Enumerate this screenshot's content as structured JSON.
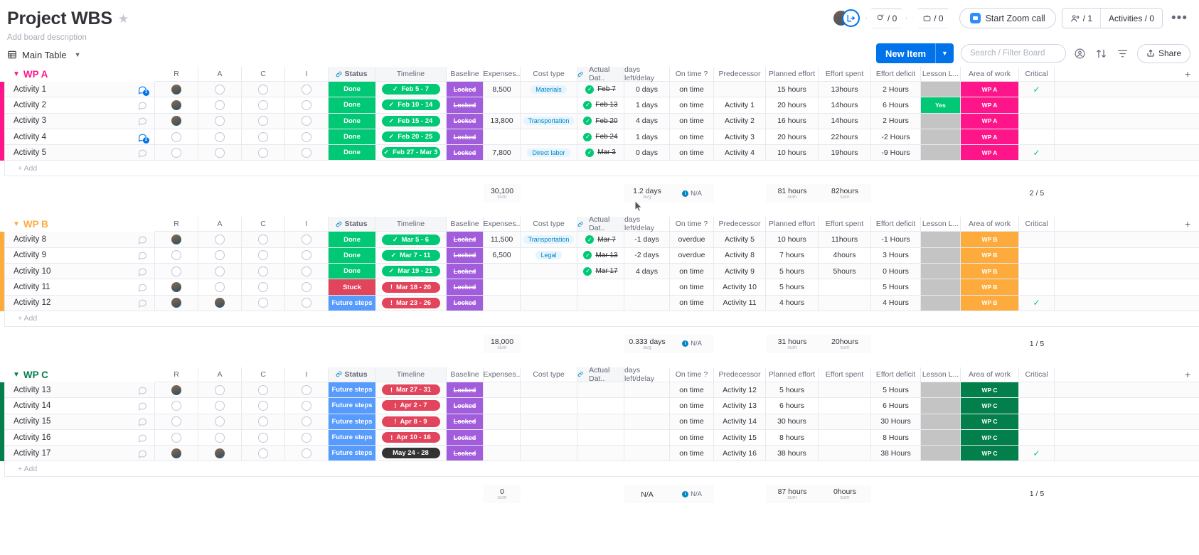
{
  "header": {
    "title": "Project WBS",
    "star_icon": "star-icon",
    "description": "Add board description",
    "view_tab": "Main Table",
    "grid_icon": "grid-icon",
    "people_count": "/ 0",
    "robot_count": "/ 0",
    "zoom_call": "Start Zoom call",
    "members": "/ 1",
    "activities": "Activities / 0",
    "dots": "•••"
  },
  "toolbar": {
    "new_item": "New Item",
    "new_item_caret": "∨",
    "search_placeholder": "Search / Filter Board",
    "person_icon": "person-filter-icon",
    "sort_icon": "sort-icon",
    "filter_icon": "filter-icon",
    "share": "Share",
    "share_icon": "share-icon"
  },
  "columns": [
    {
      "key": "R",
      "label": "R"
    },
    {
      "key": "A",
      "label": "A"
    },
    {
      "key": "C",
      "label": "C"
    },
    {
      "key": "I",
      "label": "I"
    },
    {
      "key": "status",
      "label": "Status",
      "linked": true
    },
    {
      "key": "timeline",
      "label": "Timeline"
    },
    {
      "key": "baseline",
      "label": "Baseline"
    },
    {
      "key": "expenses",
      "label": "Expenses.."
    },
    {
      "key": "cost_type",
      "label": "Cost type"
    },
    {
      "key": "actual_date",
      "label": "Actual Dat..",
      "linked": true
    },
    {
      "key": "days_left",
      "label": "days left/delay"
    },
    {
      "key": "on_time",
      "label": "On time ?"
    },
    {
      "key": "predecessor",
      "label": "Predecessor"
    },
    {
      "key": "planned_effort",
      "label": "Planned effort"
    },
    {
      "key": "effort_spent",
      "label": "Effort spent"
    },
    {
      "key": "effort_deficit",
      "label": "Effort deficit"
    },
    {
      "key": "lesson",
      "label": "Lesson L..."
    },
    {
      "key": "area",
      "label": "Area of work"
    },
    {
      "key": "critical",
      "label": "Critical"
    }
  ],
  "add_label": "+ Add",
  "colors": {
    "wpa": "#ff158a",
    "wpb": "#fdab3d",
    "wpc": "#037f4c",
    "done": "#00c875",
    "stuck": "#e2445c",
    "future": "#579bfc",
    "locked": "#a25ddc",
    "dark": "#333333",
    "blue": "#0073ea",
    "grey": "#c4c4c4",
    "green_cell": "#00c875"
  },
  "groups": [
    {
      "name": "WP A",
      "color": "#ff158a",
      "rows": [
        {
          "name": "Activity 1",
          "chat": "1",
          "chat_active": true,
          "R": "img",
          "A": "ph",
          "C": "ph",
          "I": "ph",
          "status": "Done",
          "status_color": "#00c875",
          "timeline": "Feb 5 - 7",
          "tl_color": "#00c875",
          "tl_mark": "✓",
          "baseline": "Locked",
          "expenses": "8,500",
          "cost_type": "Materials",
          "actual": "Feb 7",
          "actual_ok": true,
          "days": "0 days",
          "on_time": "on time",
          "pred": "",
          "pe": "15 hours",
          "es": "13hours",
          "ed": "2 Hours",
          "lesson": "",
          "lesson_color": "#c4c4c4",
          "area": "WP A",
          "critical": true
        },
        {
          "name": "Activity 2",
          "chat": "",
          "chat_active": false,
          "R": "img",
          "A": "ph",
          "C": "ph",
          "I": "ph",
          "status": "Done",
          "status_color": "#00c875",
          "timeline": "Feb 10 - 14",
          "tl_color": "#00c875",
          "tl_mark": "✓",
          "baseline": "Locked",
          "expenses": "",
          "cost_type": "",
          "actual": "Feb 13",
          "actual_ok": true,
          "days": "1 days",
          "on_time": "on time",
          "pred": "Activity 1",
          "pe": "20 hours",
          "es": "14hours",
          "ed": "6 Hours",
          "lesson": "Yes",
          "lesson_color": "#00c875",
          "area": "WP A",
          "critical": false
        },
        {
          "name": "Activity 3",
          "chat": "",
          "chat_active": false,
          "R": "img",
          "A": "ph",
          "C": "ph",
          "I": "ph",
          "status": "Done",
          "status_color": "#00c875",
          "timeline": "Feb 15 - 24",
          "tl_color": "#00c875",
          "tl_mark": "✓",
          "baseline": "Locked",
          "expenses": "13,800",
          "cost_type": "Transportation",
          "actual": "Feb 20",
          "actual_ok": true,
          "days": "4 days",
          "on_time": "on time",
          "pred": "Activity 2",
          "pe": "16 hours",
          "es": "14hours",
          "ed": "2 Hours",
          "lesson": "",
          "lesson_color": "#c4c4c4",
          "area": "WP A",
          "critical": false
        },
        {
          "name": "Activity 4",
          "chat": "2",
          "chat_active": true,
          "R": "ph",
          "A": "ph",
          "C": "ph",
          "I": "ph",
          "status": "Done",
          "status_color": "#00c875",
          "timeline": "Feb 20 - 25",
          "tl_color": "#00c875",
          "tl_mark": "✓",
          "baseline": "Locked",
          "expenses": "",
          "cost_type": "",
          "actual": "Feb 24",
          "actual_ok": true,
          "days": "1 days",
          "on_time": "on time",
          "pred": "Activity 3",
          "pe": "20 hours",
          "es": "22hours",
          "ed": "-2 Hours",
          "lesson": "",
          "lesson_color": "#c4c4c4",
          "area": "WP A",
          "critical": false
        },
        {
          "name": "Activity 5",
          "chat": "",
          "chat_active": false,
          "R": "ph",
          "A": "ph",
          "C": "ph",
          "I": "ph",
          "status": "Done",
          "status_color": "#00c875",
          "timeline": "Feb 27 - Mar 3",
          "tl_color": "#00c875",
          "tl_mark": "✓",
          "baseline": "Locked",
          "expenses": "7,800",
          "cost_type": "Direct labor",
          "actual": "Mar 3",
          "actual_ok": true,
          "days": "0 days",
          "on_time": "on time",
          "pred": "Activity 4",
          "pe": "10 hours",
          "es": "19hours",
          "ed": "-9 Hours",
          "lesson": "",
          "lesson_color": "#c4c4c4",
          "area": "WP A",
          "critical": true
        }
      ],
      "summary": {
        "expenses": "30,100",
        "expenses_sub": "sum",
        "days": "1.2 days",
        "days_sub": "avg",
        "on_time": "N/A",
        "pe": "81 hours",
        "pe_sub": "sum",
        "es": "82hours",
        "es_sub": "sum",
        "critical": "2 / 5"
      }
    },
    {
      "name": "WP B",
      "color": "#fdab3d",
      "rows": [
        {
          "name": "Activity 8",
          "chat": "",
          "chat_active": false,
          "R": "img",
          "A": "ph",
          "C": "ph",
          "I": "ph",
          "status": "Done",
          "status_color": "#00c875",
          "timeline": "Mar 5 - 6",
          "tl_color": "#00c875",
          "tl_mark": "✓",
          "baseline": "Locked",
          "expenses": "11,500",
          "cost_type": "Transportation",
          "actual": "Mar 7",
          "actual_ok": true,
          "days": "-1 days",
          "on_time": "overdue",
          "pred": "Activity 5",
          "pe": "10 hours",
          "es": "11hours",
          "ed": "-1 Hours",
          "lesson": "",
          "lesson_color": "#c4c4c4",
          "area": "WP B",
          "critical": false
        },
        {
          "name": "Activity 9",
          "chat": "",
          "chat_active": false,
          "R": "ph",
          "A": "ph",
          "C": "ph",
          "I": "ph",
          "status": "Done",
          "status_color": "#00c875",
          "timeline": "Mar 7 - 11",
          "tl_color": "#00c875",
          "tl_mark": "✓",
          "baseline": "Locked",
          "expenses": "6,500",
          "cost_type": "Legal",
          "actual": "Mar 13",
          "actual_ok": true,
          "days": "-2 days",
          "on_time": "overdue",
          "pred": "Activity 8",
          "pe": "7 hours",
          "es": "4hours",
          "ed": "3 Hours",
          "lesson": "",
          "lesson_color": "#c4c4c4",
          "area": "WP B",
          "critical": false
        },
        {
          "name": "Activity 10",
          "chat": "",
          "chat_active": false,
          "R": "ph",
          "A": "ph",
          "C": "ph",
          "I": "ph",
          "status": "Done",
          "status_color": "#00c875",
          "timeline": "Mar 19 - 21",
          "tl_color": "#00c875",
          "tl_mark": "✓",
          "baseline": "Locked",
          "expenses": "",
          "cost_type": "",
          "actual": "Mar 17",
          "actual_ok": true,
          "days": "4 days",
          "on_time": "on time",
          "pred": "Activity 9",
          "pe": "5 hours",
          "es": "5hours",
          "ed": "0 Hours",
          "lesson": "",
          "lesson_color": "#c4c4c4",
          "area": "WP B",
          "critical": false
        },
        {
          "name": "Activity 11",
          "chat": "",
          "chat_active": false,
          "R": "img",
          "A": "ph",
          "C": "ph",
          "I": "ph",
          "status": "Stuck",
          "status_color": "#e2445c",
          "timeline": "Mar 18 - 20",
          "tl_color": "#e2445c",
          "tl_mark": "!",
          "baseline": "Locked",
          "expenses": "",
          "cost_type": "",
          "actual": "",
          "actual_ok": false,
          "days": "",
          "on_time": "on time",
          "pred": "Activity 10",
          "pe": "5 hours",
          "es": "",
          "ed": "5 Hours",
          "lesson": "",
          "lesson_color": "#c4c4c4",
          "area": "WP B",
          "critical": false
        },
        {
          "name": "Activity 12",
          "chat": "",
          "chat_active": false,
          "R": "img",
          "A": "img",
          "C": "ph",
          "I": "ph",
          "status": "Future steps",
          "status_color": "#579bfc",
          "timeline": "Mar 23 - 26",
          "tl_color": "#e2445c",
          "tl_mark": "!",
          "baseline": "Locked",
          "expenses": "",
          "cost_type": "",
          "actual": "",
          "actual_ok": false,
          "days": "",
          "on_time": "on time",
          "pred": "Activity 11",
          "pe": "4 hours",
          "es": "",
          "ed": "4 Hours",
          "lesson": "",
          "lesson_color": "#c4c4c4",
          "area": "WP B",
          "critical": true
        }
      ],
      "summary": {
        "expenses": "18,000",
        "expenses_sub": "sum",
        "days": "0.333 days",
        "days_sub": "avg",
        "on_time": "N/A",
        "pe": "31 hours",
        "pe_sub": "sum",
        "es": "20hours",
        "es_sub": "sum",
        "critical": "1 / 5"
      }
    },
    {
      "name": "WP C",
      "color": "#037f4c",
      "rows": [
        {
          "name": "Activity 13",
          "chat": "",
          "chat_active": false,
          "R": "img",
          "A": "ph",
          "C": "ph",
          "I": "ph",
          "status": "Future steps",
          "status_color": "#579bfc",
          "timeline": "Mar 27 - 31",
          "tl_color": "#e2445c",
          "tl_mark": "!",
          "baseline": "Locked",
          "expenses": "",
          "cost_type": "",
          "actual": "",
          "actual_ok": false,
          "days": "",
          "on_time": "on time",
          "pred": "Activity 12",
          "pe": "5 hours",
          "es": "",
          "ed": "5 Hours",
          "lesson": "",
          "lesson_color": "#c4c4c4",
          "area": "WP C",
          "critical": false
        },
        {
          "name": "Activity 14",
          "chat": "",
          "chat_active": false,
          "R": "ph",
          "A": "ph",
          "C": "ph",
          "I": "ph",
          "status": "Future steps",
          "status_color": "#579bfc",
          "timeline": "Apr 2 - 7",
          "tl_color": "#e2445c",
          "tl_mark": "!",
          "baseline": "Locked",
          "expenses": "",
          "cost_type": "",
          "actual": "",
          "actual_ok": false,
          "days": "",
          "on_time": "on time",
          "pred": "Activity 13",
          "pe": "6 hours",
          "es": "",
          "ed": "6 Hours",
          "lesson": "",
          "lesson_color": "#c4c4c4",
          "area": "WP C",
          "critical": false
        },
        {
          "name": "Activity 15",
          "chat": "",
          "chat_active": false,
          "R": "ph",
          "A": "ph",
          "C": "ph",
          "I": "ph",
          "status": "Future steps",
          "status_color": "#579bfc",
          "timeline": "Apr 8 - 9",
          "tl_color": "#e2445c",
          "tl_mark": "!",
          "baseline": "Locked",
          "expenses": "",
          "cost_type": "",
          "actual": "",
          "actual_ok": false,
          "days": "",
          "on_time": "on time",
          "pred": "Activity 14",
          "pe": "30 hours",
          "es": "",
          "ed": "30 Hours",
          "lesson": "",
          "lesson_color": "#c4c4c4",
          "area": "WP C",
          "critical": false
        },
        {
          "name": "Activity 16",
          "chat": "",
          "chat_active": false,
          "R": "ph",
          "A": "ph",
          "C": "ph",
          "I": "ph",
          "status": "Future steps",
          "status_color": "#579bfc",
          "timeline": "Apr 10 - 16",
          "tl_color": "#e2445c",
          "tl_mark": "!",
          "baseline": "Locked",
          "expenses": "",
          "cost_type": "",
          "actual": "",
          "actual_ok": false,
          "days": "",
          "on_time": "on time",
          "pred": "Activity 15",
          "pe": "8 hours",
          "es": "",
          "ed": "8 Hours",
          "lesson": "",
          "lesson_color": "#c4c4c4",
          "area": "WP C",
          "critical": false
        },
        {
          "name": "Activity 17",
          "chat": "",
          "chat_active": false,
          "R": "img",
          "A": "img",
          "C": "ph",
          "I": "ph",
          "status": "Future steps",
          "status_color": "#579bfc",
          "timeline": "May 24 - 28",
          "tl_color": "#333333",
          "tl_mark": "",
          "baseline": "Locked",
          "expenses": "",
          "cost_type": "",
          "actual": "",
          "actual_ok": false,
          "days": "",
          "on_time": "on time",
          "pred": "Activity 16",
          "pe": "38 hours",
          "es": "",
          "ed": "38 Hours",
          "lesson": "",
          "lesson_color": "#c4c4c4",
          "area": "WP C",
          "critical": true
        }
      ],
      "summary": {
        "expenses": "0",
        "expenses_sub": "sum",
        "days": "N/A",
        "days_sub": "",
        "on_time": "N/A",
        "pe": "87 hours",
        "pe_sub": "sum",
        "es": "0hours",
        "es_sub": "sum",
        "critical": "1 / 5"
      }
    }
  ]
}
